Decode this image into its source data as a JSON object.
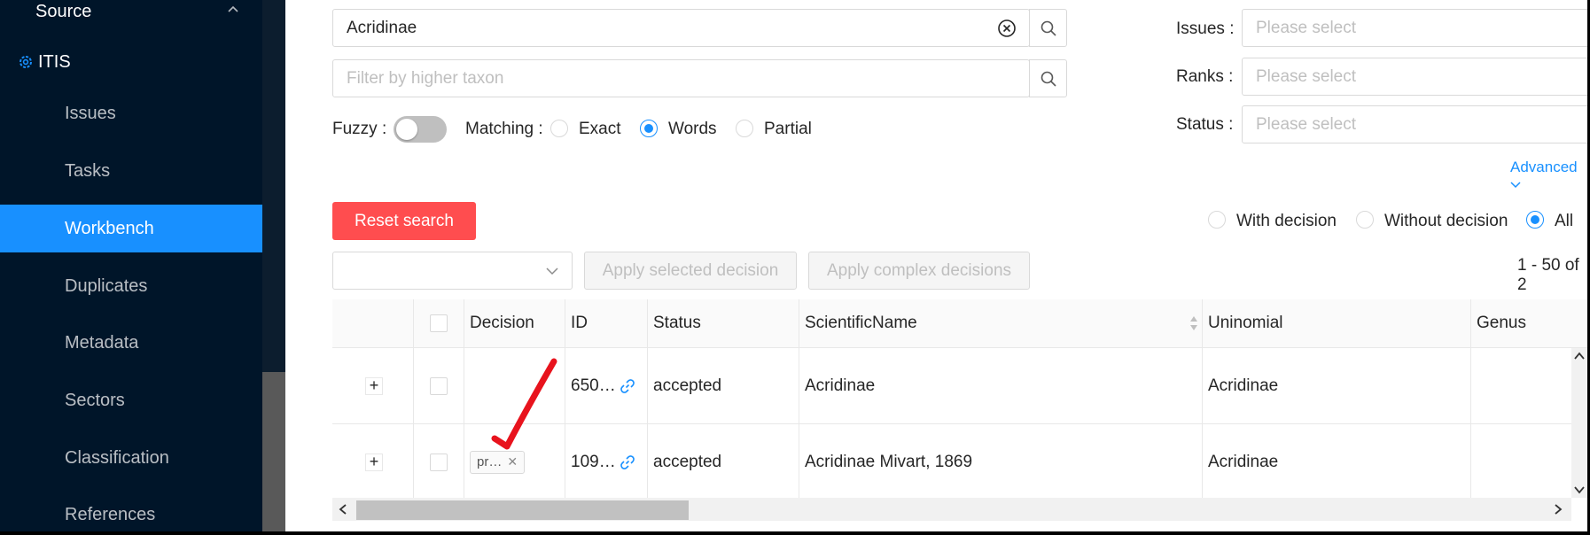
{
  "sidebar": {
    "source_label": "Source",
    "dataset_label": "ITIS",
    "items": [
      {
        "label": "Issues"
      },
      {
        "label": "Tasks"
      },
      {
        "label": "Workbench",
        "active": true
      },
      {
        "label": "Duplicates"
      },
      {
        "label": "Metadata"
      },
      {
        "label": "Sectors"
      },
      {
        "label": "Classification"
      },
      {
        "label": "References"
      }
    ]
  },
  "search": {
    "query": "Acridinae",
    "higher_taxon_placeholder": "Filter by higher taxon"
  },
  "options": {
    "fuzzy_label": "Fuzzy",
    "fuzzy_on": false,
    "matching_label": "Matching",
    "matching_options": [
      "Exact",
      "Words",
      "Partial"
    ],
    "matching_selected": "Words"
  },
  "filters": {
    "issues_label": "Issues",
    "ranks_label": "Ranks",
    "status_label": "Status",
    "placeholder": "Please select",
    "advanced_label": "Advanced"
  },
  "actions": {
    "reset_label": "Reset search",
    "apply_selected_label": "Apply selected decision",
    "apply_complex_label": "Apply complex decisions"
  },
  "decision_filter": {
    "options": [
      "With decision",
      "Without decision",
      "All"
    ],
    "selected": "All"
  },
  "pagination_text": "1 - 50 of 2",
  "table": {
    "columns": [
      "Decision",
      "ID",
      "Status",
      "ScientificName",
      "Uninomial",
      "Genus"
    ],
    "rows": [
      {
        "decision": "",
        "id": "650…",
        "status": "accepted",
        "scientific_name": "Acridinae",
        "uninomial": "Acridinae",
        "genus": ""
      },
      {
        "decision": "pr…",
        "id": "109…",
        "status": "accepted",
        "scientific_name": "Acridinae Mivart, 1869",
        "uninomial": "Acridinae",
        "genus": ""
      }
    ]
  },
  "colors": {
    "sidebar_bg": "#001529",
    "primary": "#1890ff",
    "danger": "#ff4d4f",
    "annotation": "#e8131d"
  }
}
